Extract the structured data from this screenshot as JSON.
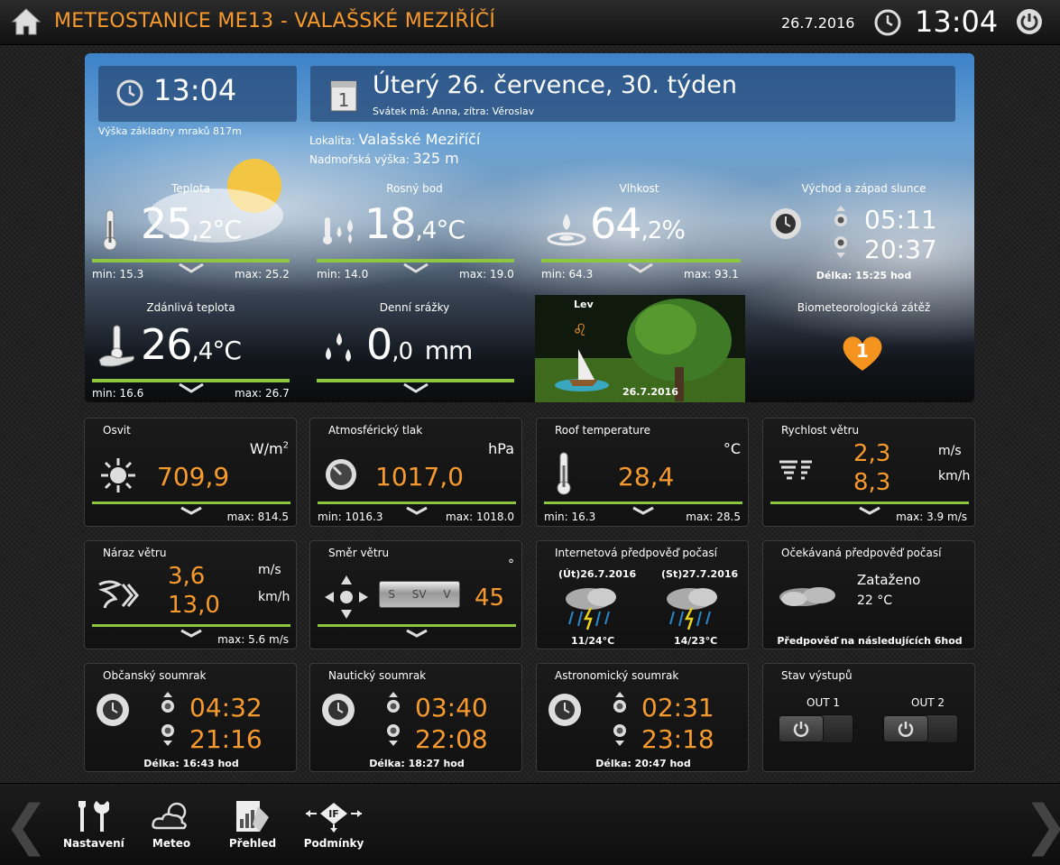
{
  "header": {
    "title": "METEOSTANICE ME13 - VALAŠSKÉ MEZIŘÍČÍ",
    "date": "26.7.2016",
    "time": "13:04"
  },
  "hero": {
    "time": "13:04",
    "cloud_base": "Výška základny mraků 817m",
    "date_line": "Úterý 26. července, 30. týden",
    "nameday": "Svátek má: Anna, zítra: Věroslav",
    "locality_label": "Lokalita:",
    "locality_value": "Valašské Meziříčí",
    "altitude_label": "Nadmořská výška:",
    "altitude_value": "325 m",
    "temperature": {
      "label": "Teplota",
      "int": "25",
      "dec": ",2",
      "unit": "°C",
      "min": "min: 15.3",
      "max": "max: 25.2"
    },
    "dewpoint": {
      "label": "Rosný bod",
      "int": "18",
      "dec": ",4",
      "unit": "°C",
      "min": "min: 14.0",
      "max": "max: 19.0"
    },
    "humidity": {
      "label": "Vlhkost",
      "int": "64",
      "dec": ",2",
      "unit": "%",
      "min": "min: 64.3",
      "max": "max: 93.1"
    },
    "sun": {
      "label": "Východ a západ slunce",
      "rise": "05:11",
      "set": "20:37",
      "length": "Délka: 15:25 hod"
    },
    "apparent": {
      "label": "Zdánlivá teplota",
      "int": "26",
      "dec": ",4",
      "unit": "°C",
      "min": "min: 16.6",
      "max": "max: 26.7"
    },
    "rain": {
      "label": "Denní srážky",
      "int": "0",
      "dec": ",0",
      "unit": "mm"
    },
    "zodiac": {
      "label": "Lev",
      "date": "26.7.2016"
    },
    "biometeo": {
      "label": "Biometeorologická zátěž",
      "value": "1"
    }
  },
  "panels": {
    "osvit": {
      "title": "Osvit",
      "unit": "W/m",
      "unit_sup": "2",
      "value": "709,9",
      "max": "max: 814.5"
    },
    "pressure": {
      "title": "Atmosférický tlak",
      "unit": "hPa",
      "value": "1017,0",
      "min": "min: 1016.3",
      "max": "max: 1018.0"
    },
    "roof": {
      "title": "Roof temperature",
      "unit": "°C",
      "value": "28,4",
      "min": "min: 16.3",
      "max": "max: 28.5"
    },
    "wind": {
      "title": "Rychlost větru",
      "value1": "2,3",
      "value2": "8,3",
      "unit1": "m/s",
      "unit2": "km/h",
      "max": "max: 3.9 m/s"
    },
    "gust": {
      "title": "Náraz větru",
      "value1": "3,6",
      "value2": "13,0",
      "unit1": "m/s",
      "unit2": "km/h",
      "max": "max: 5.6 m/s"
    },
    "direction": {
      "title": "Směr větru",
      "unit": "°",
      "value": "45",
      "compass": [
        "S",
        "SV",
        "V"
      ]
    },
    "forecast_net": {
      "title": "Internetová předpověď počasí",
      "day1": "(Út)26.7.2016",
      "day2": "(St)27.7.2016",
      "temp1": "11/24°C",
      "temp2": "14/23°C"
    },
    "forecast_local": {
      "title": "Očekávaná předpověď počasí",
      "condition": "Zataženo",
      "temp": "22 °C",
      "note": "Předpověď na následujících 6hod"
    },
    "civil": {
      "title": "Občanský soumrak",
      "rise": "04:32",
      "set": "21:16",
      "length": "Délka: 16:43 hod"
    },
    "nautical": {
      "title": "Nautický soumrak",
      "rise": "03:40",
      "set": "22:08",
      "length": "Délka: 18:27 hod"
    },
    "astro": {
      "title": "Astronomický soumrak",
      "rise": "02:31",
      "set": "23:18",
      "length": "Délka: 20:47 hod"
    },
    "outputs": {
      "title": "Stav výstupů",
      "out1": "OUT 1",
      "out2": "OUT 2"
    }
  },
  "nav": {
    "settings": "Nastavení",
    "meteo": "Meteo",
    "overview": "Přehled",
    "conditions": "Podmínky",
    "if_label": "IF"
  },
  "colors": {
    "accent": "#f79a2e",
    "bar": "#8dc63f"
  }
}
